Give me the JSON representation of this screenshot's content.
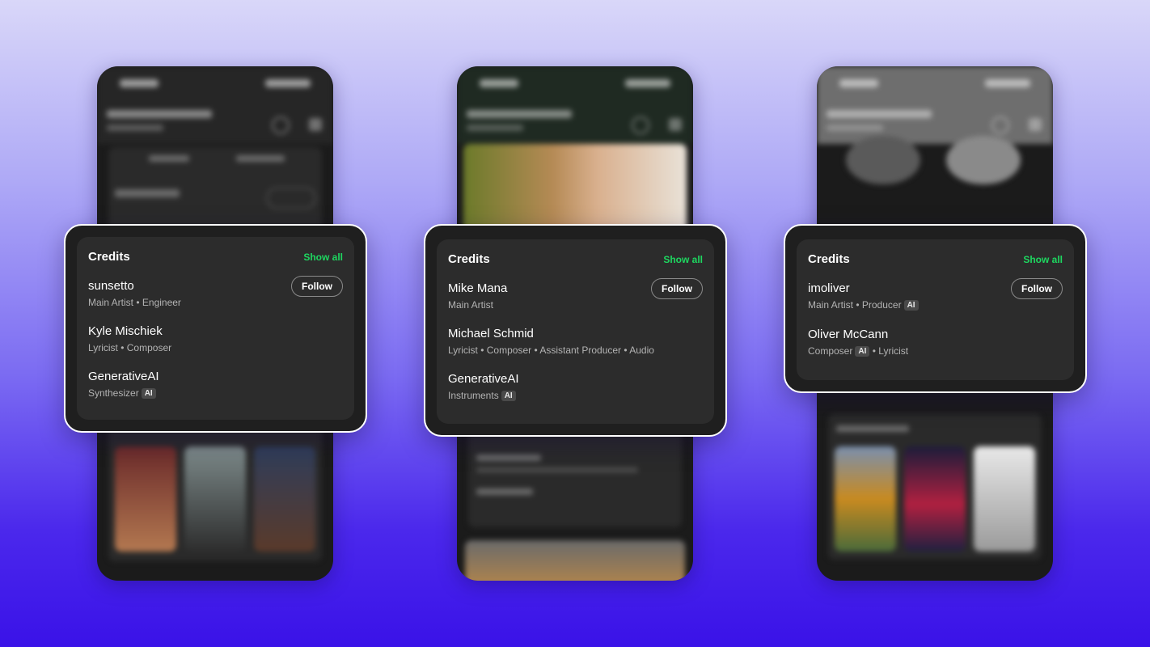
{
  "cards": [
    {
      "title": "Credits",
      "show_all": "Show all",
      "follow_label": "Follow",
      "people": [
        {
          "name": "sunsetto",
          "roles": "Main Artist • Engineer",
          "ai": false,
          "follow": true
        },
        {
          "name": "Kyle Mischiek",
          "roles": "Lyricist • Composer",
          "ai": false,
          "follow": false
        },
        {
          "name": "GenerativeAI",
          "roles": "Synthesizer",
          "ai": true,
          "ai_label": "AI",
          "follow": false
        }
      ]
    },
    {
      "title": "Credits",
      "show_all": "Show all",
      "follow_label": "Follow",
      "people": [
        {
          "name": "Mike Mana",
          "roles": "Main Artist",
          "ai": false,
          "follow": true
        },
        {
          "name": "Michael Schmid",
          "roles": "Lyricist • Composer • Assistant Producer • Audio",
          "ai": false,
          "follow": false
        },
        {
          "name": "GenerativeAI",
          "roles": "Instruments",
          "ai": true,
          "ai_label": "AI",
          "follow": false
        }
      ]
    },
    {
      "title": "Credits",
      "show_all": "Show all",
      "follow_label": "Follow",
      "people": [
        {
          "name": "imoliver",
          "roles": "Main Artist • Producer",
          "ai": true,
          "ai_label": "AI",
          "follow": true
        },
        {
          "name": "Oliver McCann",
          "roles_before": "Composer",
          "ai_label": "AI",
          "roles_after": "• Lyricist",
          "follow": false
        }
      ]
    }
  ],
  "colors": {
    "accent_green": "#1ed760",
    "card_bg": "#2c2c2c",
    "frame_bg": "#1f1f1f",
    "text_secondary": "#b3b3b3"
  }
}
